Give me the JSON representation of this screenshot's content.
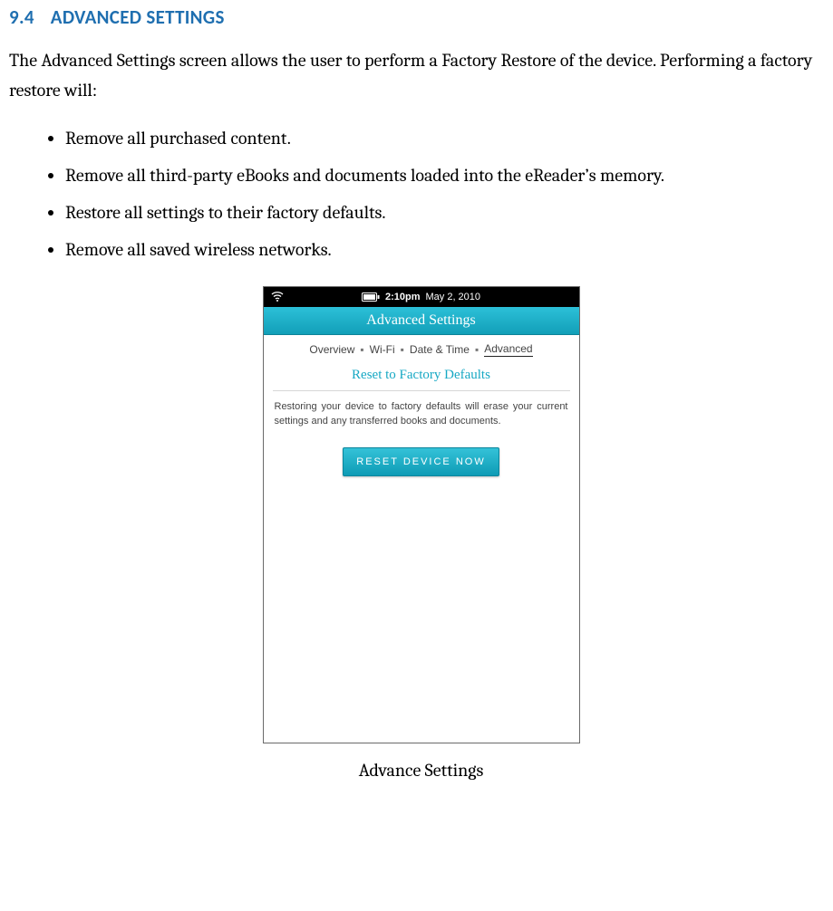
{
  "heading": {
    "number": "9.4",
    "title": "ADVANCED SETTINGS"
  },
  "intro": "The Advanced Settings screen allows the user to perform a Factory Restore of the device. Performing a factory restore will:",
  "bullets": [
    "Remove all purchased content.",
    "Remove all third-party eBooks and documents loaded into the eReader’s memory.",
    "Restore all settings to their factory defaults.",
    "Remove all saved wireless networks."
  ],
  "device": {
    "status": {
      "time": "2:10pm",
      "date": "May 2, 2010"
    },
    "title": "Advanced Settings",
    "tabs": [
      "Overview",
      "Wi-Fi",
      "Date & Time",
      "Advanced"
    ],
    "active_tab_index": 3,
    "section_title": "Reset to Factory Defaults",
    "body_text": "Restoring your device to factory defaults will erase your current settings and any transferred books and documents.",
    "button_label": "RESET DEVICE NOW"
  },
  "caption": "Advance Settings"
}
